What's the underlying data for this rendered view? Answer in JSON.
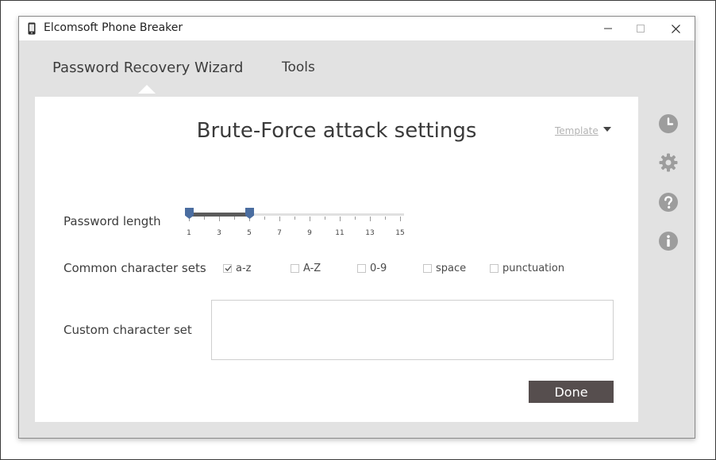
{
  "window": {
    "title": "Elcomsoft Phone Breaker",
    "controls": [
      "minimize",
      "maximize",
      "close"
    ]
  },
  "nav": {
    "tabs": [
      {
        "label": "Password Recovery Wizard",
        "active": true
      },
      {
        "label": "Tools",
        "active": false
      }
    ]
  },
  "panel": {
    "title": "Brute-Force attack settings",
    "template_label": "Template"
  },
  "password_length": {
    "label": "Password length",
    "min": 1,
    "max": 15,
    "tick_labels": [
      "1",
      "3",
      "5",
      "7",
      "9",
      "11",
      "13",
      "15"
    ],
    "range_from": 1,
    "range_to": 5
  },
  "charsets": {
    "label": "Common character sets",
    "items": [
      {
        "label": "a-z",
        "checked": true
      },
      {
        "label": "A-Z",
        "checked": false
      },
      {
        "label": "0-9",
        "checked": false
      },
      {
        "label": "space",
        "checked": false
      },
      {
        "label": "punctuation",
        "checked": false
      }
    ]
  },
  "custom": {
    "label": "Custom character set",
    "value": ""
  },
  "done_label": "Done",
  "side_icons": [
    "history-icon",
    "settings-icon",
    "help-icon",
    "info-icon"
  ],
  "colors": {
    "thumb": "#4a6da0",
    "done_button": "#564e4e",
    "side_icon": "#9d9d9d",
    "background": "#e2e2e2"
  }
}
